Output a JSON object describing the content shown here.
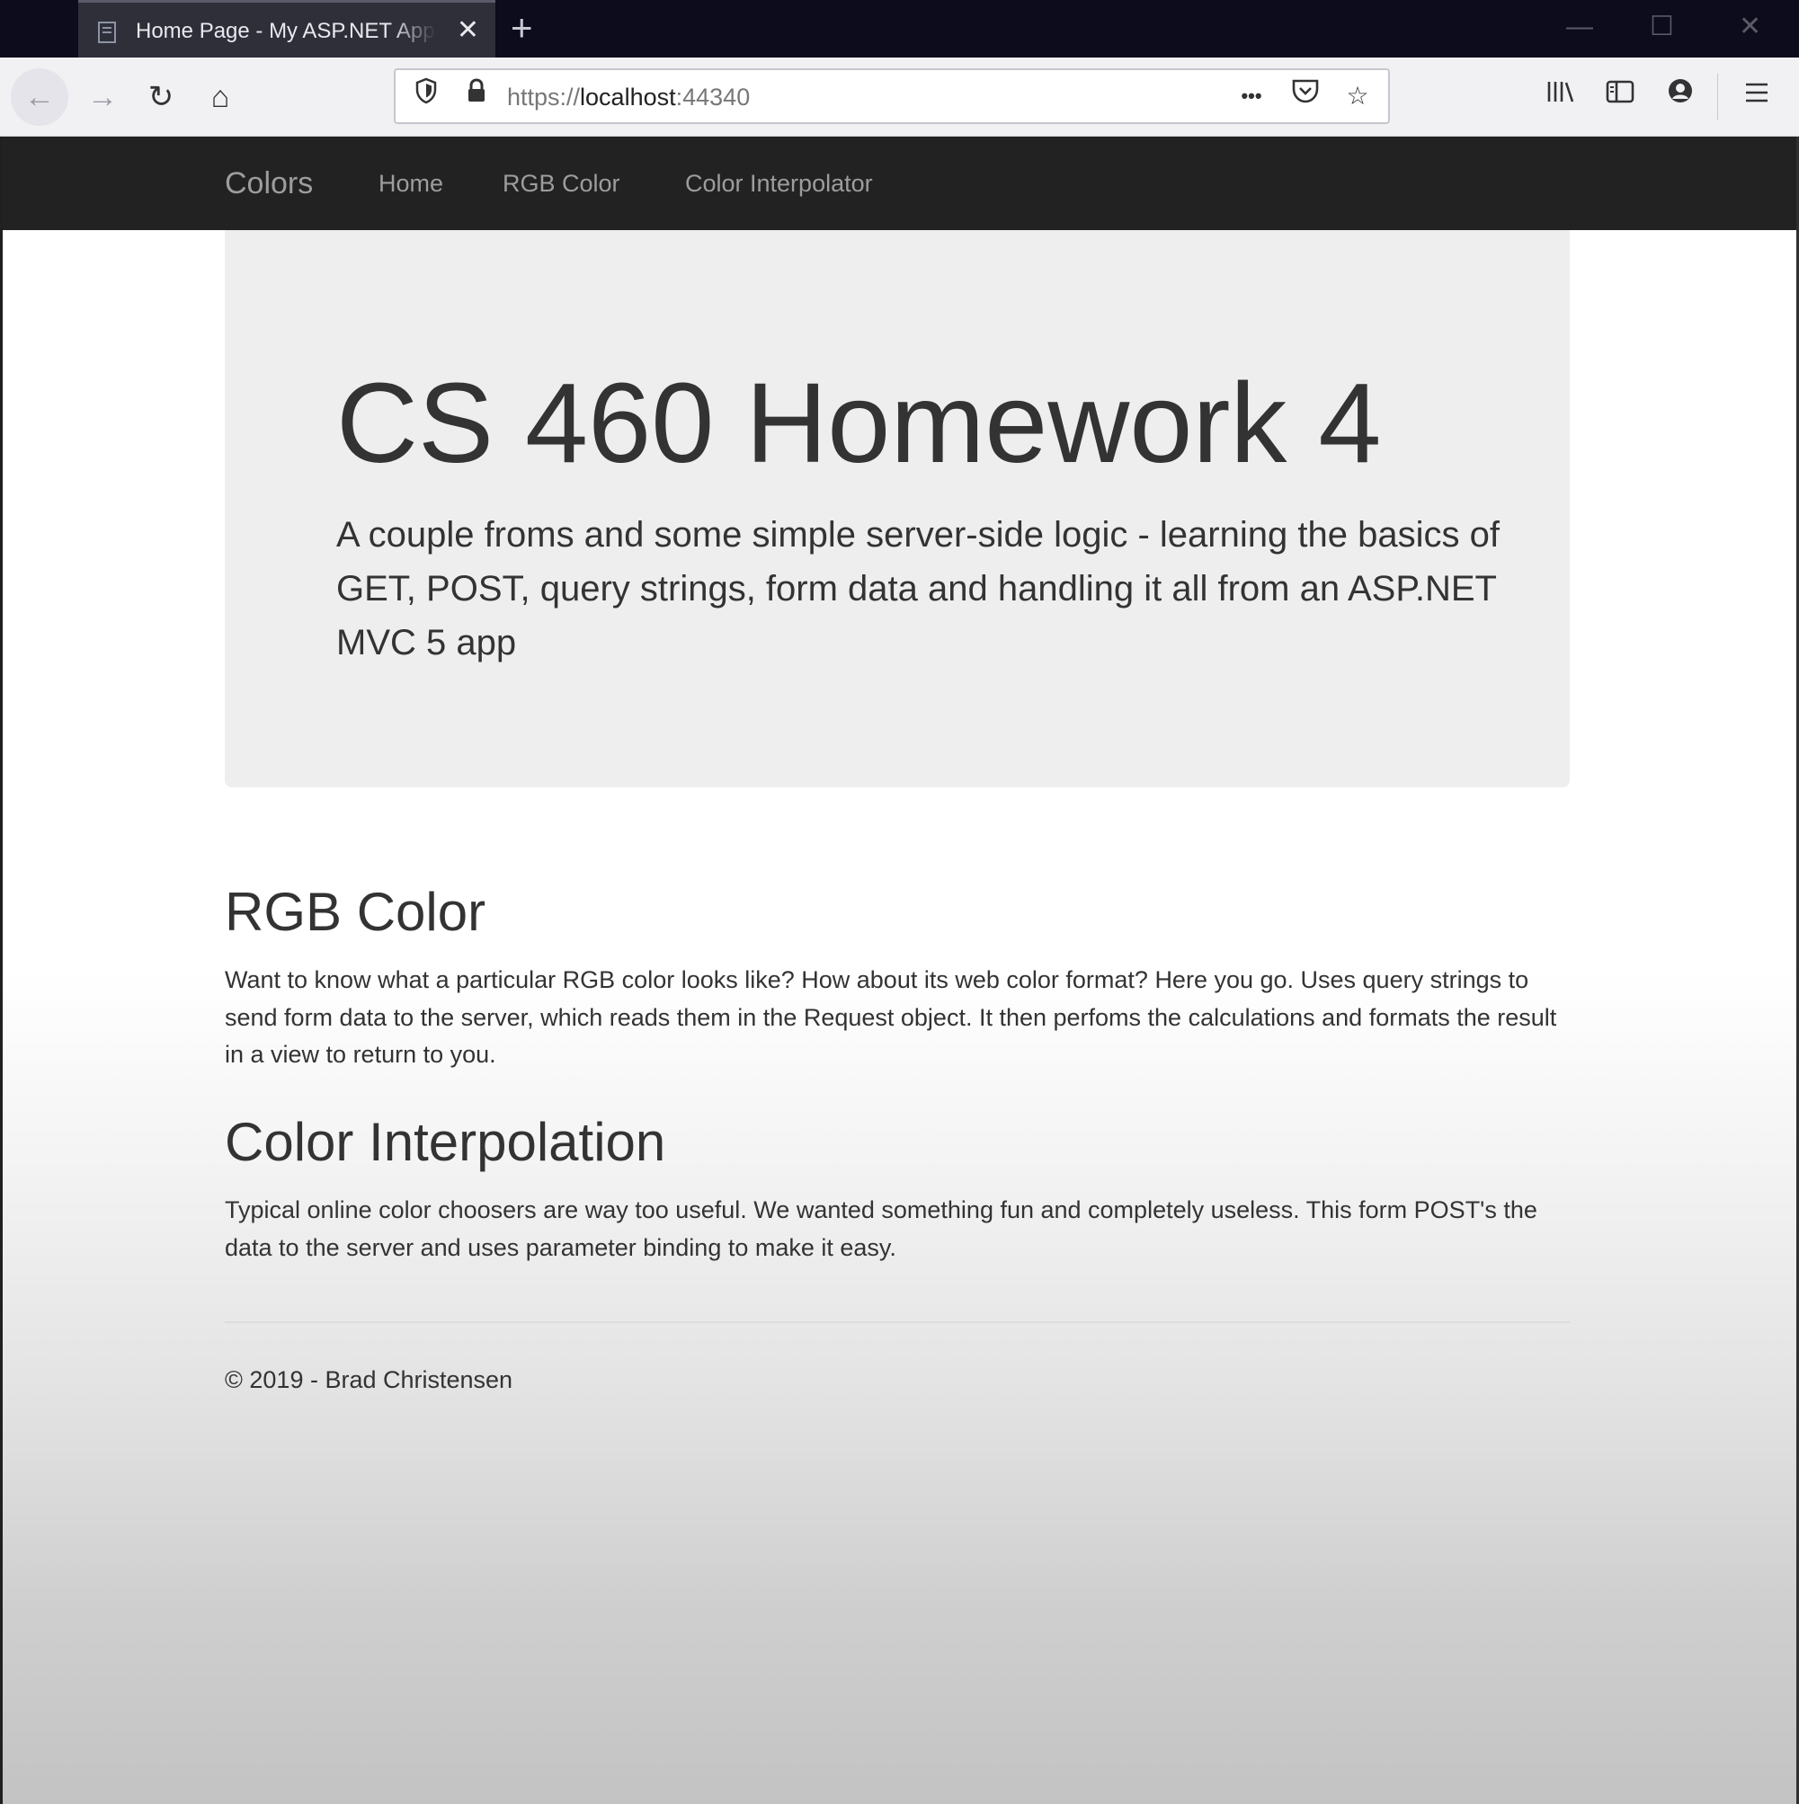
{
  "browser": {
    "tab": {
      "title": "Home Page - My ASP.NET Application",
      "favicon": "page-icon",
      "close_glyph": "✕"
    },
    "new_tab_glyph": "+",
    "window_controls": {
      "minimize": "—",
      "maximize": "☐",
      "close": "✕"
    },
    "toolbar": {
      "back_glyph": "←",
      "forward_glyph": "→",
      "reload_glyph": "↻",
      "home_glyph": "⌂",
      "shield_glyph": "⛉",
      "lock_glyph": "🔒",
      "more_glyph": "•••",
      "pocket_glyph": "♥",
      "bookmark_glyph": "☆",
      "library_glyph": "|||\\",
      "sidebar_glyph": "◫",
      "account_glyph": "◉",
      "menu_glyph": "≡"
    },
    "url": {
      "scheme": "https://",
      "host": "localhost",
      "port": ":44340"
    }
  },
  "navbar": {
    "brand": "Colors",
    "links": [
      "Home",
      "RGB Color",
      "Color Interpolator"
    ]
  },
  "jumbotron": {
    "title": "CS 460 Homework 4",
    "lead": "A couple froms and some simple server-side logic - learning the basics of GET, POST, query strings, form data and handling it all from an ASP.NET MVC 5 app"
  },
  "sections": [
    {
      "title": "RGB Color",
      "text": "Want to know what a particular RGB color looks like? How about its web color format? Here you go. Uses query strings to send form data to the server, which reads them in the Request object. It then perfoms the calculations and formats the result in a view to return to you."
    },
    {
      "title": "Color Interpolation",
      "text": "Typical online color choosers are way too useful. We wanted something fun and completely useless. This form POST's the data to the server and uses parameter binding to make it easy."
    }
  ],
  "footer": {
    "text": "© 2019 - Brad Christensen"
  },
  "colors": {
    "navbar_bg": "#222222",
    "navbar_text": "#9d9d9d",
    "jumbotron_bg": "#eeeeee",
    "text": "#333333"
  }
}
